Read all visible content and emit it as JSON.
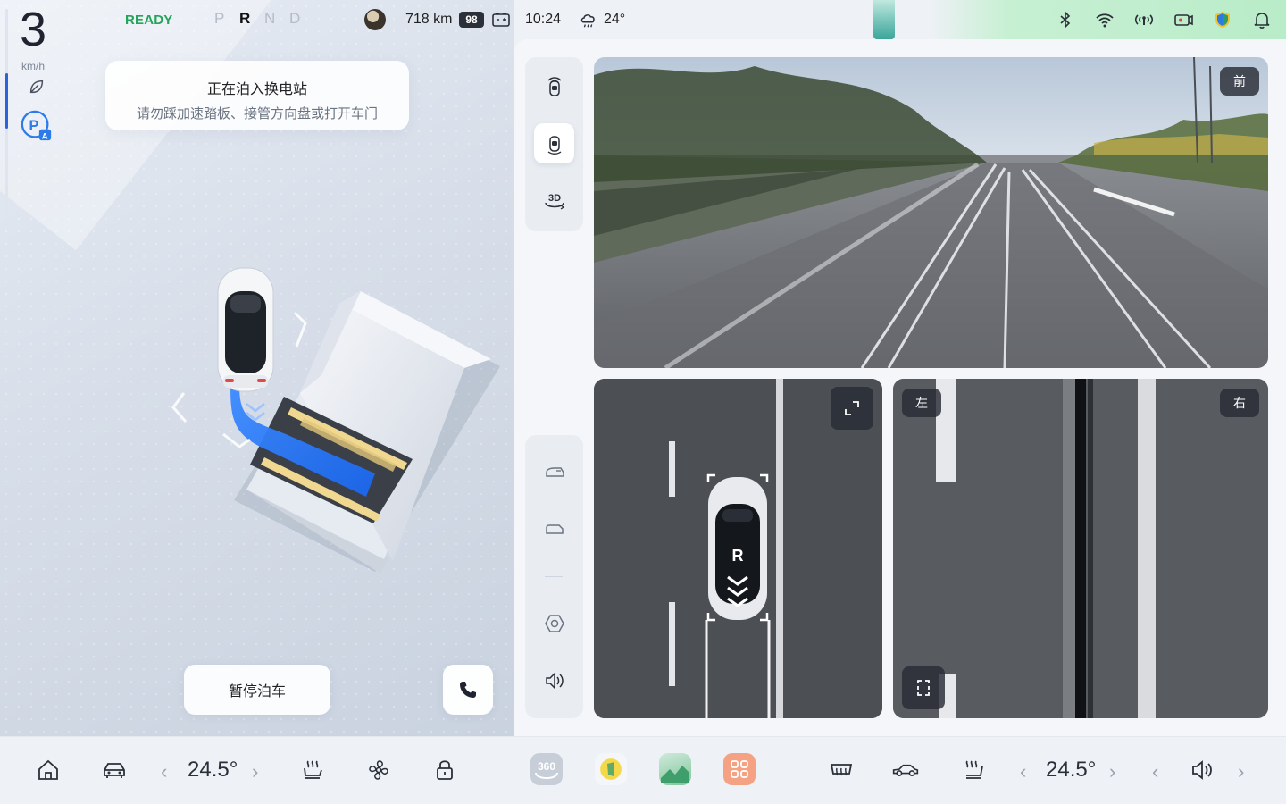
{
  "status": {
    "ready": "READY",
    "gears": [
      "P",
      "R",
      "N",
      "D"
    ],
    "active_gear": "R",
    "range": "718 km",
    "battery_pct": "98",
    "time": "10:24",
    "outside_temp": "24°"
  },
  "speed": {
    "value": "3",
    "unit": "km/h"
  },
  "parking": {
    "toast_title": "正在泊入换电站",
    "toast_sub": "请勿踩加速踏板、接管方向盘或打开车门",
    "pause_label": "暂停泊车"
  },
  "cameras": {
    "front_label": "前",
    "left_label": "左",
    "right_label": "右",
    "gear_on_car": "R"
  },
  "dock": {
    "driver_temp": "24.5°",
    "passenger_temp": "24.5°",
    "app_360_label": "360"
  },
  "colors": {
    "accent": "#2c63d8",
    "ready": "#23a45a",
    "path": "#1f6cf0"
  },
  "icons": {
    "status_right": [
      "bluetooth-icon",
      "wifi-icon",
      "signal-icon",
      "dashcam-icon",
      "shield-icon",
      "bell-icon"
    ],
    "side_top": [
      "sensor-front-icon",
      "sensor-top-icon",
      "view-3d-icon"
    ],
    "side_bottom": [
      "car-front-view-icon",
      "car-side-view-icon",
      "radar-icon",
      "volume-icon"
    ]
  }
}
